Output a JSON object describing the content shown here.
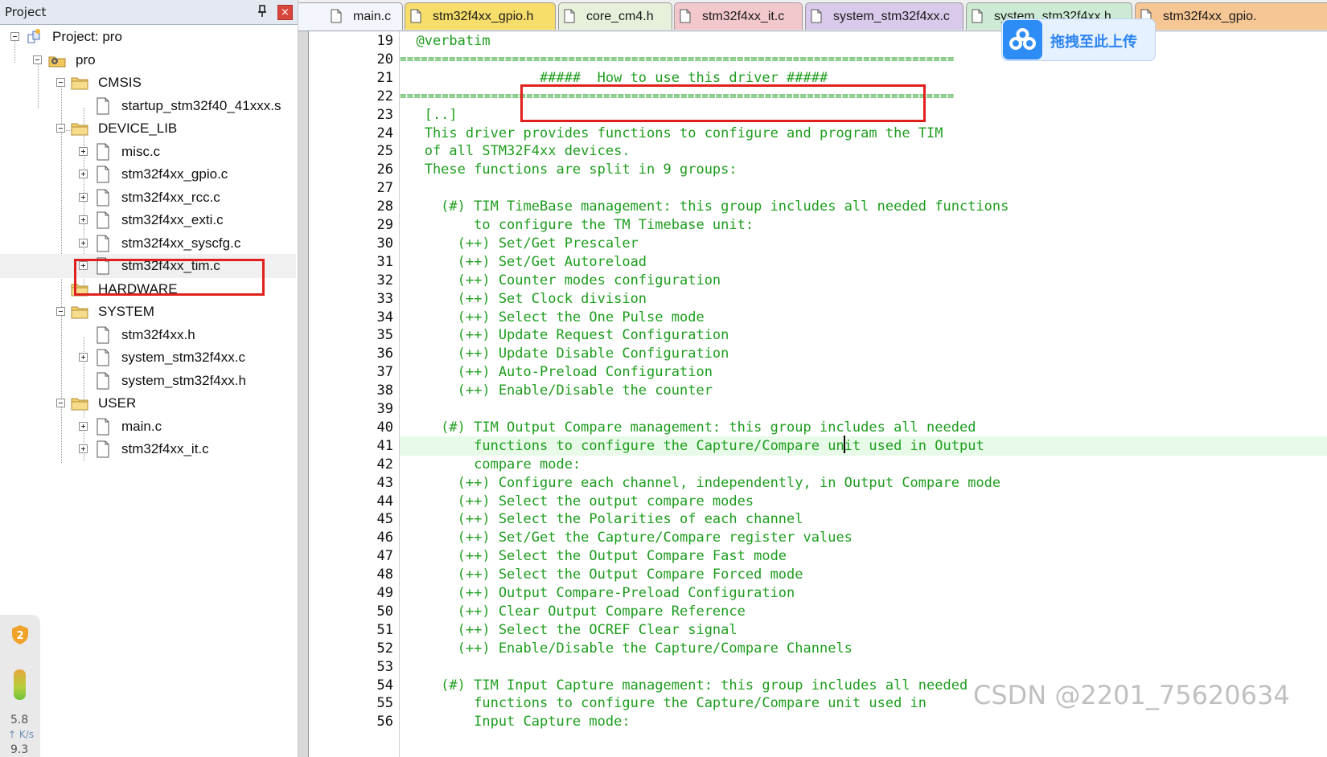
{
  "project_panel": {
    "title": "Project",
    "pin_symbol": "ᵽ",
    "close_symbol": "×",
    "tree": [
      {
        "label": "Project: pro",
        "level": 0,
        "kind": "project",
        "expander": "minus"
      },
      {
        "label": "pro",
        "level": 1,
        "kind": "target",
        "expander": "minus"
      },
      {
        "label": "CMSIS",
        "level": 2,
        "kind": "folder",
        "expander": "minus"
      },
      {
        "label": "startup_stm32f40_41xxx.s",
        "level": 3,
        "kind": "file",
        "expander": "none"
      },
      {
        "label": "DEVICE_LIB",
        "level": 2,
        "kind": "folder",
        "expander": "minus"
      },
      {
        "label": "misc.c",
        "level": 3,
        "kind": "file",
        "expander": "plus"
      },
      {
        "label": "stm32f4xx_gpio.c",
        "level": 3,
        "kind": "file",
        "expander": "plus"
      },
      {
        "label": "stm32f4xx_rcc.c",
        "level": 3,
        "kind": "file",
        "expander": "plus"
      },
      {
        "label": "stm32f4xx_exti.c",
        "level": 3,
        "kind": "file",
        "expander": "plus"
      },
      {
        "label": "stm32f4xx_syscfg.c",
        "level": 3,
        "kind": "file",
        "expander": "plus"
      },
      {
        "label": "stm32f4xx_tim.c",
        "level": 3,
        "kind": "file",
        "expander": "plus",
        "selected": true
      },
      {
        "label": "HARDWARE",
        "level": 2,
        "kind": "folder",
        "expander": "none"
      },
      {
        "label": "SYSTEM",
        "level": 2,
        "kind": "folder",
        "expander": "minus"
      },
      {
        "label": "stm32f4xx.h",
        "level": 3,
        "kind": "file",
        "expander": "none"
      },
      {
        "label": "system_stm32f4xx.c",
        "level": 3,
        "kind": "file",
        "expander": "plus"
      },
      {
        "label": "system_stm32f4xx.h",
        "level": 3,
        "kind": "file",
        "expander": "none"
      },
      {
        "label": "USER",
        "level": 2,
        "kind": "folder",
        "expander": "minus"
      },
      {
        "label": "main.c",
        "level": 3,
        "kind": "file",
        "expander": "plus"
      },
      {
        "label": "stm32f4xx_it.c",
        "level": 3,
        "kind": "file",
        "expander": "plus"
      }
    ],
    "speed_widget": {
      "badge": "2",
      "value": "5.8",
      "unit": "↑ K/s",
      "value2": "9.3"
    }
  },
  "tabs": [
    {
      "label": "main.c",
      "color": "#f2f6fc"
    },
    {
      "label": "stm32f4xx_gpio.h",
      "color": "#f7de6a"
    },
    {
      "label": "core_cm4.h",
      "color": "#e7f0da"
    },
    {
      "label": "stm32f4xx_it.c",
      "color": "#f3c8cd"
    },
    {
      "label": "system_stm32f4xx.c",
      "color": "#d9c9ea"
    },
    {
      "label": "system_stm32f4xx.h",
      "color": "#cdebd4"
    },
    {
      "label": "stm32f4xx_gpio.",
      "color": "#f6c694"
    }
  ],
  "upload_badge": {
    "label": "拖拽至此上传",
    "icon": "cloud-upload-icon"
  },
  "code": {
    "current_line": 41,
    "lines": [
      {
        "n": "19",
        "text": "  @verbatim"
      },
      {
        "n": "20",
        "text": "==============================================================================="
      },
      {
        "n": "21",
        "text": "                 #####  How to use this driver #####"
      },
      {
        "n": "22",
        "text": "==============================================================================="
      },
      {
        "n": "23",
        "text": "   [..]"
      },
      {
        "n": "24",
        "text": "   This driver provides functions to configure and program the TIM"
      },
      {
        "n": "25",
        "text": "   of all STM32F4xx devices."
      },
      {
        "n": "26",
        "text": "   These functions are split in 9 groups:"
      },
      {
        "n": "27",
        "text": ""
      },
      {
        "n": "28",
        "text": "     (#) TIM TimeBase management: this group includes all needed functions"
      },
      {
        "n": "29",
        "text": "         to configure the TM Timebase unit:"
      },
      {
        "n": "30",
        "text": "       (++) Set/Get Prescaler"
      },
      {
        "n": "31",
        "text": "       (++) Set/Get Autoreload"
      },
      {
        "n": "32",
        "text": "       (++) Counter modes configuration"
      },
      {
        "n": "33",
        "text": "       (++) Set Clock division"
      },
      {
        "n": "34",
        "text": "       (++) Select the One Pulse mode"
      },
      {
        "n": "35",
        "text": "       (++) Update Request Configuration"
      },
      {
        "n": "36",
        "text": "       (++) Update Disable Configuration"
      },
      {
        "n": "37",
        "text": "       (++) Auto-Preload Configuration"
      },
      {
        "n": "38",
        "text": "       (++) Enable/Disable the counter"
      },
      {
        "n": "39",
        "text": ""
      },
      {
        "n": "40",
        "text": "     (#) TIM Output Compare management: this group includes all needed"
      },
      {
        "n": "41",
        "text": "         functions to configure the Capture/Compare unit used in Output"
      },
      {
        "n": "42",
        "text": "         compare mode:"
      },
      {
        "n": "43",
        "text": "       (++) Configure each channel, independently, in Output Compare mode"
      },
      {
        "n": "44",
        "text": "       (++) Select the output compare modes"
      },
      {
        "n": "45",
        "text": "       (++) Select the Polarities of each channel"
      },
      {
        "n": "46",
        "text": "       (++) Set/Get the Capture/Compare register values"
      },
      {
        "n": "47",
        "text": "       (++) Select the Output Compare Fast mode"
      },
      {
        "n": "48",
        "text": "       (++) Select the Output Compare Forced mode"
      },
      {
        "n": "49",
        "text": "       (++) Output Compare-Preload Configuration"
      },
      {
        "n": "50",
        "text": "       (++) Clear Output Compare Reference"
      },
      {
        "n": "51",
        "text": "       (++) Select the OCREF Clear signal"
      },
      {
        "n": "52",
        "text": "       (++) Enable/Disable the Capture/Compare Channels"
      },
      {
        "n": "53",
        "text": ""
      },
      {
        "n": "54",
        "text": "     (#) TIM Input Capture management: this group includes all needed"
      },
      {
        "n": "55",
        "text": "         functions to configure the Capture/Compare unit used in"
      },
      {
        "n": "56",
        "text": "         Input Capture mode:"
      }
    ]
  },
  "watermark": "CSDN @2201_75620634",
  "colors": {
    "code_text": "#1f9e1f",
    "highlight_box": "#e0201c",
    "current_line_bg": "#e8fbe8",
    "upload_accent": "#2e8cf7"
  }
}
